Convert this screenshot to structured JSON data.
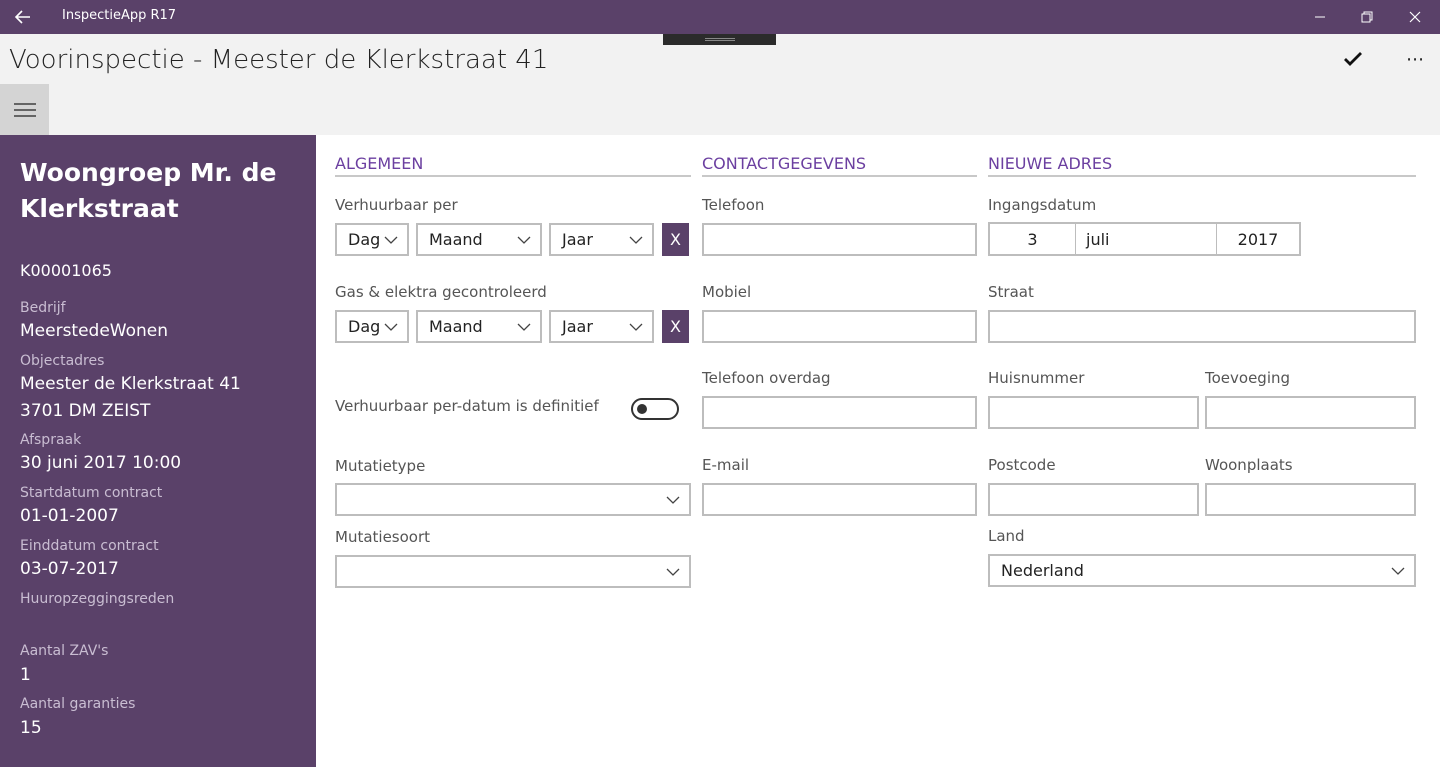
{
  "window": {
    "title": "InspectieApp R17"
  },
  "header": {
    "title": "Voorinspectie - Meester de Klerkstraat 41"
  },
  "sidebar": {
    "group_name": "Woongroep Mr. de Klerkstraat",
    "code": "K00001065",
    "fields": [
      {
        "label": "Bedrijf",
        "value": "MeerstedeWonen"
      },
      {
        "label": "Objectadres",
        "value": "Meester de Klerkstraat 41",
        "value2": "3701 DM  ZEIST"
      },
      {
        "label": "Afspraak",
        "value": "30 juni 2017  10:00"
      },
      {
        "label": "Startdatum contract",
        "value": "01-01-2007"
      },
      {
        "label": "Einddatum contract",
        "value": "03-07-2017"
      },
      {
        "label": "Huuropzeggingsreden",
        "value": ""
      },
      {
        "label": "Aantal ZAV's",
        "value": "1"
      },
      {
        "label": "Aantal garanties",
        "value": "15"
      }
    ]
  },
  "algemeen": {
    "heading": "ALGEMEEN",
    "verhuurbaar_label": "Verhuurbaar per",
    "gas_label": "Gas & elektra gecontroleerd",
    "day_placeholder": "Dag",
    "month_placeholder": "Maand",
    "year_placeholder": "Jaar",
    "clear_label": "X",
    "toggle_label": "Verhuurbaar per-datum is definitief",
    "toggle_on": false,
    "mutatietype_label": "Mutatietype",
    "mutatietype_value": "",
    "mutatiesoort_label": "Mutatiesoort",
    "mutatiesoort_value": ""
  },
  "contact": {
    "heading": "CONTACTGEGEVENS",
    "telefoon_label": "Telefoon",
    "telefoon_value": "",
    "mobiel_label": "Mobiel",
    "mobiel_value": "",
    "telefoon_overdag_label": "Telefoon overdag",
    "telefoon_overdag_value": "",
    "email_label": "E-mail",
    "email_value": ""
  },
  "nieuw_adres": {
    "heading": "NIEUWE ADRES",
    "ingangsdatum_label": "Ingangsdatum",
    "ingangsdatum_day": "3",
    "ingangsdatum_month": "juli",
    "ingangsdatum_year": "2017",
    "straat_label": "Straat",
    "straat_value": "",
    "huisnummer_label": "Huisnummer",
    "huisnummer_value": "",
    "toevoeging_label": "Toevoeging",
    "toevoeging_value": "",
    "postcode_label": "Postcode",
    "postcode_value": "",
    "woonplaats_label": "Woonplaats",
    "woonplaats_value": "",
    "land_label": "Land",
    "land_value": "Nederland"
  },
  "colors": {
    "accent": "#5a4169",
    "heading": "#6b3fa0"
  },
  "icons": [
    "back-icon",
    "minimize-icon",
    "restore-icon",
    "close-icon",
    "checkmark-icon",
    "more-icon",
    "hamburger-icon",
    "chevron-down-icon"
  ]
}
